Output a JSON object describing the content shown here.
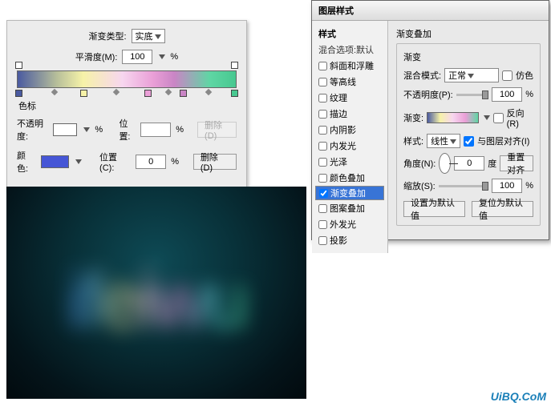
{
  "grad_editor": {
    "type_label": "渐变类型:",
    "type_value": "实底",
    "smooth_label": "平滑度(M):",
    "smooth_value": "100",
    "smooth_unit": "%",
    "stops_section": "色标",
    "opacity_label": "不透明度:",
    "opacity_unit": "%",
    "pos1_label": "位置:",
    "pos1_unit": "%",
    "delete1": "删除(D)",
    "color_label": "颜色:",
    "pos2_label": "位置(C):",
    "pos2_value": "0",
    "pos2_unit": "%",
    "delete2": "删除(D)"
  },
  "layer_style": {
    "title": "图层样式",
    "left_header": "样式",
    "left_sub": "混合选项:默认",
    "items": [
      "斜面和浮雕",
      "等高线",
      "纹理",
      "描边",
      "内阴影",
      "内发光",
      "光泽",
      "颜色叠加",
      "渐变叠加",
      "图案叠加",
      "外发光",
      "投影"
    ],
    "right": {
      "group_title": "渐变叠加",
      "sub_title": "渐变",
      "blend_label": "混合模式:",
      "blend_value": "正常",
      "dither": "仿色",
      "opacity_label": "不透明度(P):",
      "opacity_value": "100",
      "opacity_unit": "%",
      "gradient_label": "渐变:",
      "reverse": "反向(R)",
      "style_label": "样式:",
      "style_value": "线性",
      "align": "与图层对齐(I)",
      "angle_label": "角度(N):",
      "angle_value": "0",
      "angle_unit": "度",
      "reset_align": "重置对齐",
      "scale_label": "缩放(S):",
      "scale_value": "100",
      "scale_unit": "%",
      "make_default": "设置为默认值",
      "reset_default": "复位为默认值"
    }
  },
  "preview_text": "ifeiwu",
  "watermark": "UiBQ.CoM",
  "chk": {
    "off": false,
    "on": true
  }
}
